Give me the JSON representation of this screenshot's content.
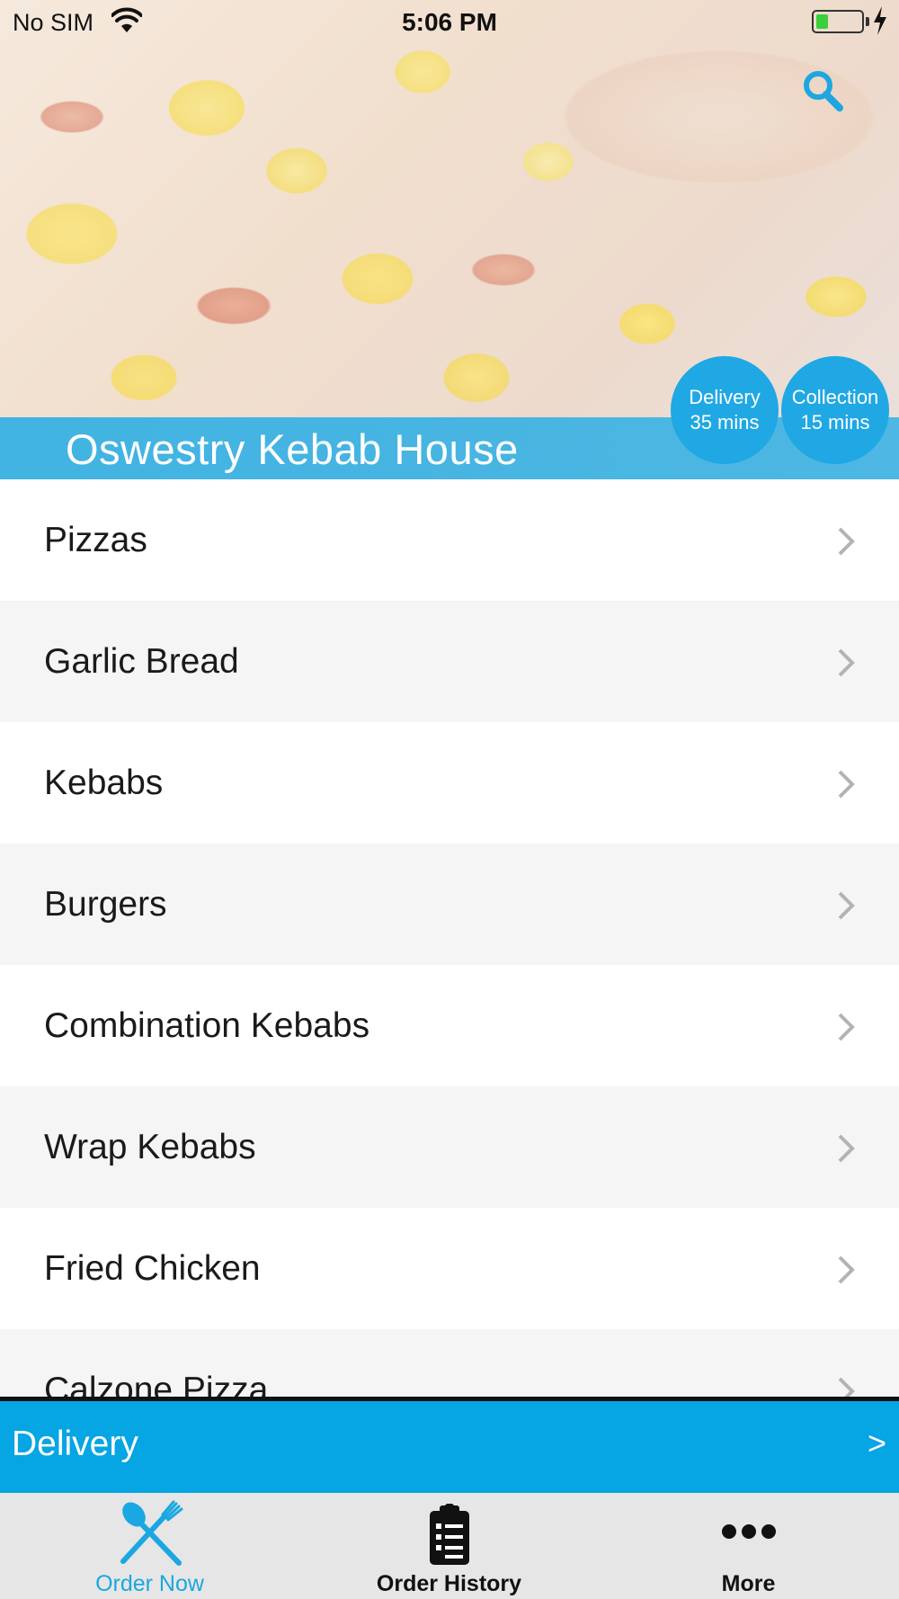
{
  "status_bar": {
    "carrier": "No SIM",
    "time": "5:06 PM"
  },
  "header": {
    "restaurant_name": "Oswestry Kebab House",
    "delivery": {
      "label": "Delivery",
      "time": "35 mins"
    },
    "collection": {
      "label": "Collection",
      "time": "15 mins"
    }
  },
  "menu": {
    "categories": [
      {
        "label": "Pizzas"
      },
      {
        "label": "Garlic Bread"
      },
      {
        "label": "Kebabs"
      },
      {
        "label": "Burgers"
      },
      {
        "label": "Combination Kebabs"
      },
      {
        "label": "Wrap Kebabs"
      },
      {
        "label": "Fried Chicken"
      },
      {
        "label": "Calzone Pizza"
      }
    ]
  },
  "order_type_bar": {
    "label": "Delivery",
    "arrow": ">"
  },
  "tab_bar": {
    "tabs": [
      {
        "label": "Order Now",
        "icon": "fork-knife-icon",
        "active": true
      },
      {
        "label": "Order History",
        "icon": "clipboard-icon",
        "active": false
      },
      {
        "label": "More",
        "icon": "ellipsis-icon",
        "active": false
      }
    ]
  },
  "colors": {
    "accent": "#06a5e4",
    "active_tab": "#1aa7e2",
    "tab_bar_bg": "#e6e6e6",
    "alt_row": "#f5f5f5"
  }
}
